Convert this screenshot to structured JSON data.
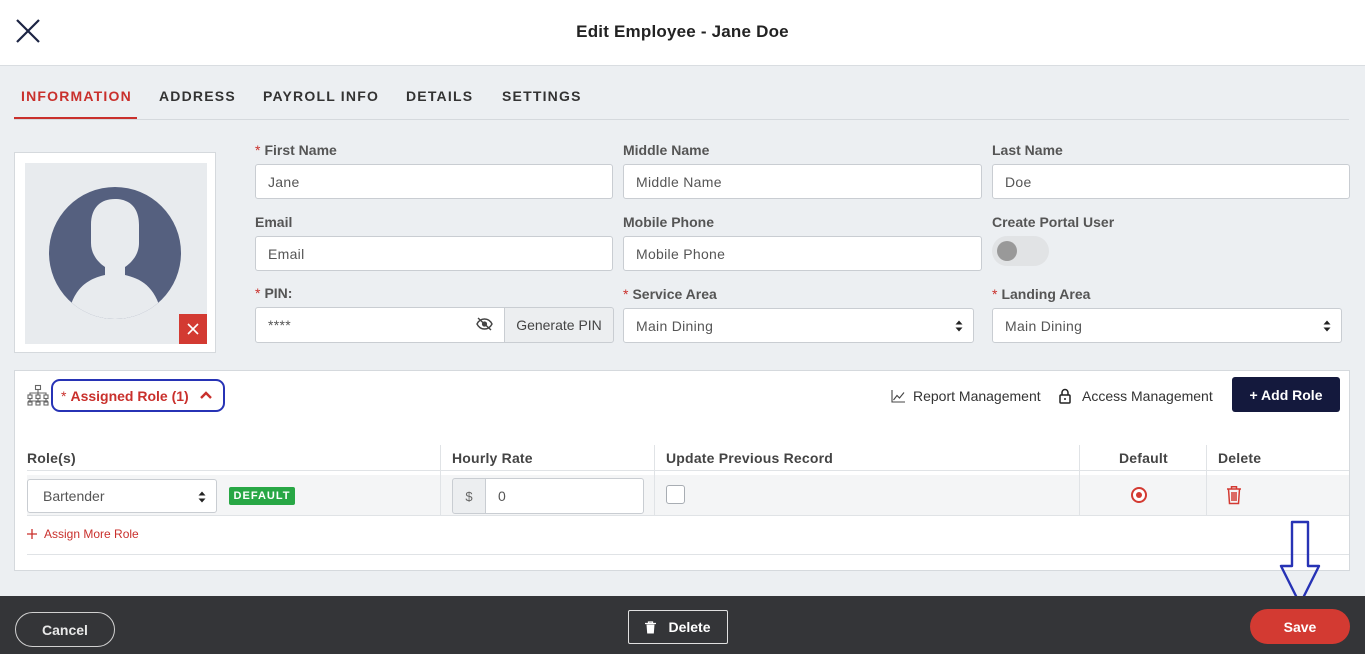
{
  "header": {
    "title": "Edit Employee - Jane Doe"
  },
  "tabs": [
    {
      "label": "INFORMATION"
    },
    {
      "label": "ADDRESS"
    },
    {
      "label": "PAYROLL INFO"
    },
    {
      "label": "DETAILS"
    },
    {
      "label": "SETTINGS"
    }
  ],
  "form": {
    "first_name": {
      "label": "First Name",
      "value": "Jane",
      "placeholder": "First Name"
    },
    "middle_name": {
      "label": "Middle Name",
      "value": "",
      "placeholder": "Middle Name"
    },
    "last_name": {
      "label": "Last Name",
      "value": "Doe",
      "placeholder": "Last Name"
    },
    "email": {
      "label": "Email",
      "value": "",
      "placeholder": "Email"
    },
    "mobile_phone": {
      "label": "Mobile Phone",
      "value": "",
      "placeholder": "Mobile Phone"
    },
    "create_portal_user": {
      "label": "Create Portal User",
      "enabled": false
    },
    "pin": {
      "label": "PIN:",
      "value": "****"
    },
    "generate_pin_label": "Generate PIN",
    "service_area": {
      "label": "Service Area",
      "value": "Main Dining"
    },
    "landing_area": {
      "label": "Landing Area",
      "value": "Main Dining"
    },
    "required_mark": "*"
  },
  "roles": {
    "section_label": "Assigned Role (1)",
    "report_management": "Report Management",
    "access_management": "Access Management",
    "add_role": "+ Add Role",
    "columns": [
      "Role(s)",
      "Hourly Rate",
      "Update Previous Record",
      "Default",
      "Delete"
    ],
    "rows": [
      {
        "role": "Bartender",
        "badge": "DEFAULT",
        "currency": "$",
        "rate": "0",
        "update_previous": false,
        "is_default": true
      }
    ],
    "assign_more": "Assign More Role"
  },
  "footer": {
    "cancel": "Cancel",
    "delete": "Delete",
    "save": "Save"
  },
  "colors": {
    "accent": "#c9302c",
    "annotation": "#2733b5",
    "add_role_bg": "#14193d",
    "footer_bg": "#343538",
    "badge_green": "#28a745"
  }
}
